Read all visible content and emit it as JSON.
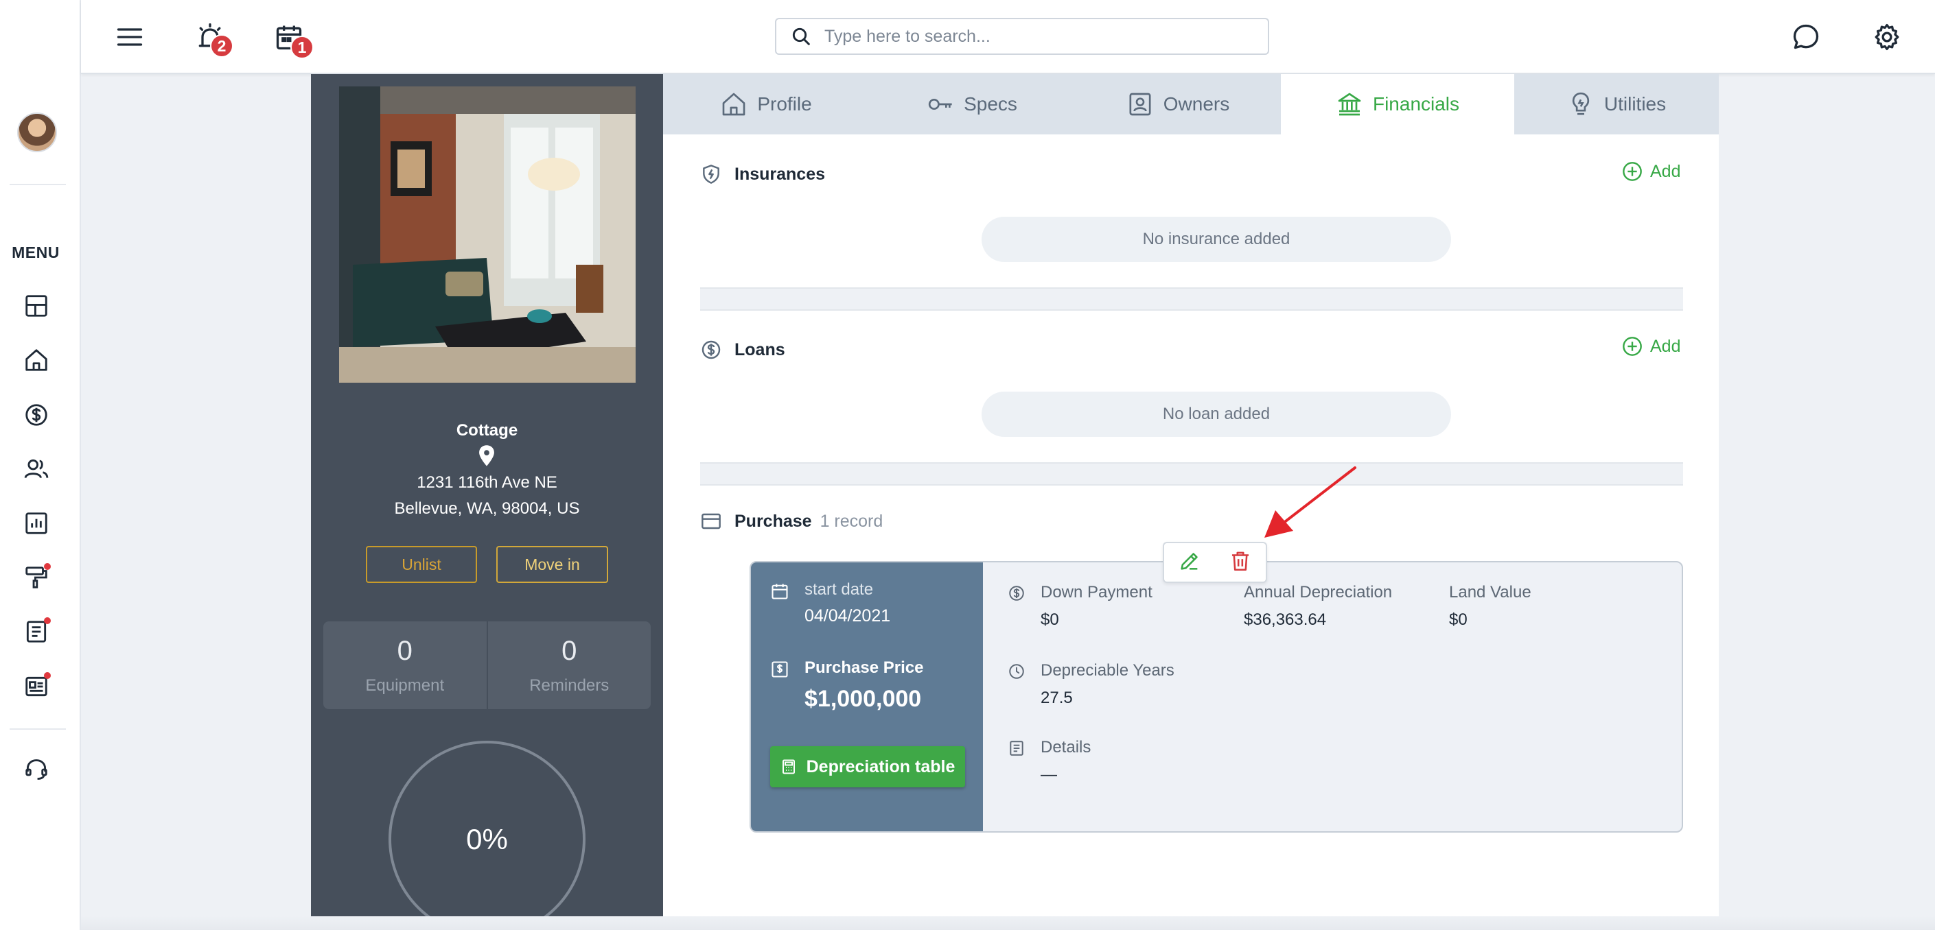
{
  "leftnav": {
    "menu_label": "MENU",
    "items": [
      "dashboard-icon",
      "home-icon",
      "dollar-icon",
      "users-icon",
      "report-icon",
      "paint-roller-icon",
      "document-icon",
      "listing-icon",
      "support-icon"
    ]
  },
  "topbar": {
    "alarm_badge": "2",
    "calendar_badge": "1",
    "search_placeholder": "Type here to search..."
  },
  "property": {
    "name": "Cottage",
    "address_line1": "1231 116th Ave NE",
    "address_line2": "Bellevue, WA, 98004, US",
    "unlist_label": "Unlist",
    "movein_label": "Move in",
    "stats": [
      {
        "value": "0",
        "label": "Equipment"
      },
      {
        "value": "0",
        "label": "Reminders"
      }
    ],
    "progress": "0%"
  },
  "tabs": [
    {
      "label": "Profile"
    },
    {
      "label": "Specs"
    },
    {
      "label": "Owners"
    },
    {
      "label": "Financials",
      "active": true
    },
    {
      "label": "Utilities"
    }
  ],
  "insurances": {
    "title": "Insurances",
    "add_label": "Add",
    "empty": "No insurance added"
  },
  "loans": {
    "title": "Loans",
    "add_label": "Add",
    "empty": "No loan added"
  },
  "purchase": {
    "title": "Purchase",
    "count": "1 record",
    "start_date_label": "start date",
    "start_date": "04/04/2021",
    "price_label": "Purchase Price",
    "price": "$1,000,000",
    "dep_button": "Depreciation table",
    "down_payment_label": "Down Payment",
    "down_payment": "$0",
    "annual_dep_label": "Annual Depreciation",
    "annual_dep": "$36,363.64",
    "land_value_label": "Land Value",
    "land_value": "$0",
    "dep_years_label": "Depreciable Years",
    "dep_years": "27.5",
    "details_label": "Details",
    "details": "—"
  },
  "colors": {
    "accent_green": "#37a846",
    "danger_red": "#d63b3f",
    "card_dark": "#464f5b",
    "record_blue": "#5f7b95"
  }
}
